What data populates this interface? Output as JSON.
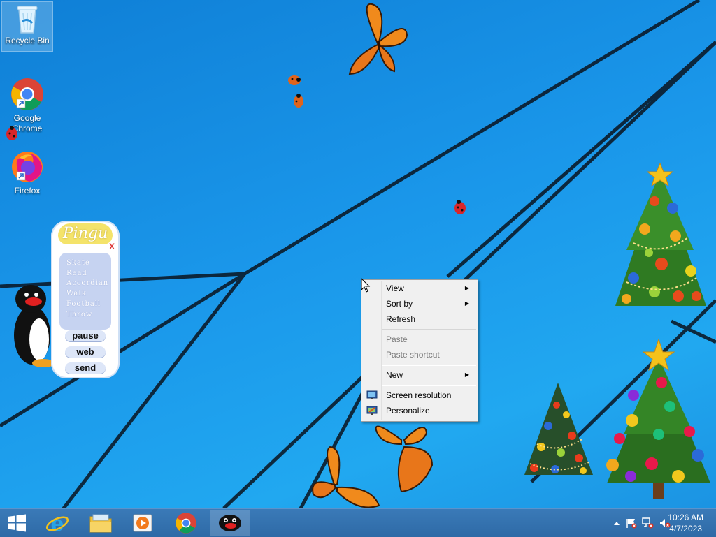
{
  "desktop": {
    "icons": [
      {
        "label": "Recycle Bin",
        "icon": "recycle-bin-icon"
      },
      {
        "label": "Google Chrome",
        "line1": "Google",
        "line2": "Chrome",
        "icon": "chrome-icon"
      },
      {
        "label": "Firefox",
        "icon": "firefox-icon"
      }
    ]
  },
  "pingu_widget": {
    "title": "Pingu",
    "close": "X",
    "menu": [
      "Skate",
      "Read",
      "Accordian",
      "Walk",
      "Football",
      "Throw"
    ],
    "buttons": {
      "pause": "pause",
      "web": "web",
      "send": "send"
    }
  },
  "context_menu": {
    "view": "View",
    "sort_by": "Sort by",
    "refresh": "Refresh",
    "paste": "Paste",
    "paste_shortcut": "Paste shortcut",
    "new": "New",
    "screen_resolution": "Screen resolution",
    "personalize": "Personalize"
  },
  "taskbar": {
    "apps": [
      "start-icon",
      "internet-explorer-icon",
      "file-explorer-icon",
      "media-player-icon",
      "chrome-icon",
      "pingu-icon"
    ],
    "tray": {
      "time": "10:26 AM",
      "date": "4/7/2023"
    }
  },
  "colors": {
    "desktop_bg": "#1a97ea",
    "taskbar": "#2e6aa6",
    "menu_bg": "#f0f0f0"
  }
}
